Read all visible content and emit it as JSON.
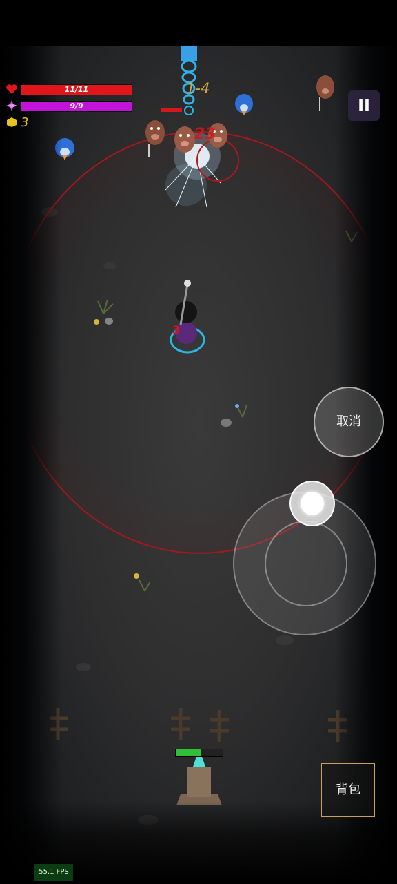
{
  "hud": {
    "hp_text": "11/11",
    "hp_fraction": 1.0,
    "mp_text": "9/9",
    "mp_fraction": 1.0,
    "gold_count": "3",
    "level_label": "1-4",
    "pause_label": "II"
  },
  "combat": {
    "damage_number": "23",
    "player_marker": "3"
  },
  "controls": {
    "cancel_label": "取消",
    "bag_label": "背包"
  },
  "tower": {
    "hp_fraction": 0.55
  },
  "debug": {
    "fps_text": "55.1 FPS"
  },
  "colors": {
    "hp": "#e0161a",
    "mp": "#c214d8",
    "gold": "#e8c319",
    "level": "#d9a83a",
    "aggro_ring": "#a1191d"
  },
  "icons": {
    "hp": "heart-icon",
    "mp": "mana-crystal-icon",
    "gold": "gold-coin-icon"
  }
}
